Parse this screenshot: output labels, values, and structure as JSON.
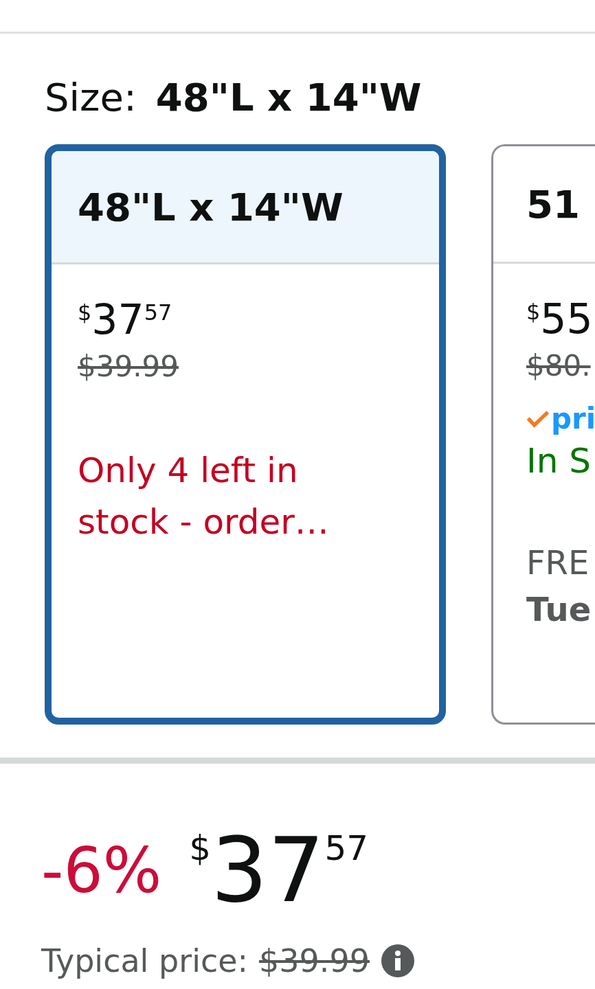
{
  "size_selector": {
    "label": "Size:",
    "value": "48\"L x 14\"W",
    "options": [
      {
        "name": "48\"L x 14\"W",
        "selected": true,
        "price_symbol": "$",
        "price_whole": "37",
        "price_fraction": "57",
        "list_price": "$39.99",
        "stock": "Only 4 left in stock - order…",
        "kind": "low"
      },
      {
        "name": "51",
        "selected": false,
        "price_symbol": "$",
        "price_whole": "55",
        "list_price": "$80.",
        "prime": "pri",
        "stock": "In S",
        "kind": "in",
        "delivery": "FRE",
        "delivery_date": "Tue"
      }
    ]
  },
  "price_block": {
    "discount": "-6%",
    "price_symbol": "$",
    "price_whole": "37",
    "price_fraction": "57",
    "typical_label": "Typical price:",
    "typical_price": "$39.99"
  }
}
